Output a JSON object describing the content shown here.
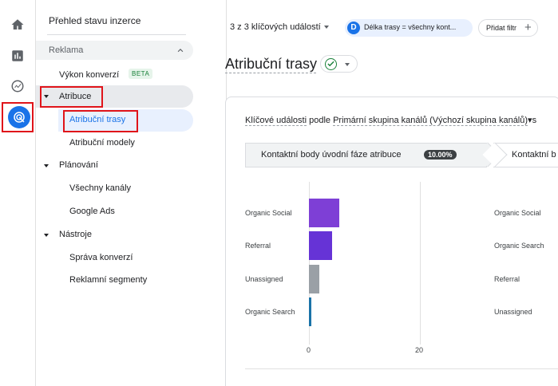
{
  "rail": {
    "icons": [
      "home-icon",
      "reports-icon",
      "explore-icon",
      "advertising-icon"
    ]
  },
  "nav": {
    "title": "Přehled stavu inzerce",
    "section": "Reklama",
    "items": {
      "vykon": "Výkon konverzí",
      "beta": "BETA",
      "atribuce": "Atribuce",
      "atribucni_trasy": "Atribuční trasy",
      "atribucni_modely": "Atribuční modely",
      "planovani": "Plánování",
      "vsechny_kanaly": "Všechny kanály",
      "google_ads": "Google Ads",
      "nastroje": "Nástroje",
      "sprava_konverzi": "Správa konverzí",
      "reklamni_segmenty": "Reklamní segmenty"
    }
  },
  "toolbar": {
    "events_select": "3 z 3 klíčových událostí",
    "chip_letter": "D",
    "chip_text": "Délka trasy = všechny kont...",
    "add_filter": "Přidat filtr"
  },
  "page": {
    "title": "Atribuční trasy"
  },
  "card": {
    "subtitle_part1": "Klíčové události",
    "subtitle_part2": " podle ",
    "subtitle_part3": "Primární skupina kanálů (Výchozí skupina kanálů)",
    "subtitle_part4": "▾s",
    "tab1_label": "Kontaktní body úvodní fáze atribuce",
    "tab1_pct": "10.00%",
    "tab2_label": "Kontaktní b"
  },
  "chart_data": {
    "type": "bar",
    "orientation": "horizontal",
    "categories": [
      "Organic Social",
      "Referral",
      "Unassigned",
      "Organic Search"
    ],
    "values": [
      5.5,
      4.2,
      1.8,
      0.5
    ],
    "colors": [
      "#7e3fd6",
      "#6633d6",
      "#9aa0a6",
      "#1a73a8"
    ],
    "xticks": [
      "0",
      "20"
    ],
    "xlim": [
      0,
      20
    ],
    "right_panel_categories": [
      "Organic Social",
      "Organic Search",
      "Referral",
      "Unassigned"
    ]
  }
}
